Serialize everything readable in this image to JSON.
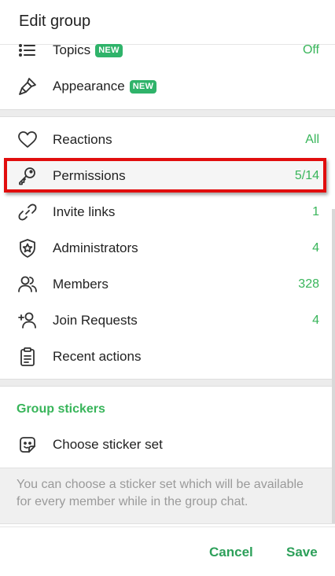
{
  "header": {
    "title": "Edit group"
  },
  "rows": {
    "topics": {
      "label": "Topics",
      "badge": "NEW",
      "value": "Off",
      "icon": "list-icon"
    },
    "appearance": {
      "label": "Appearance",
      "badge": "NEW",
      "icon": "brush-icon"
    },
    "reactions": {
      "label": "Reactions",
      "value": "All",
      "icon": "heart-icon"
    },
    "permissions": {
      "label": "Permissions",
      "value": "5/14",
      "icon": "key-icon"
    },
    "invite_links": {
      "label": "Invite links",
      "value": "1",
      "icon": "link-icon"
    },
    "administrators": {
      "label": "Administrators",
      "value": "4",
      "icon": "shield-star-icon"
    },
    "members": {
      "label": "Members",
      "value": "328",
      "icon": "users-icon"
    },
    "join_requests": {
      "label": "Join Requests",
      "value": "4",
      "icon": "add-user-icon"
    },
    "recent_actions": {
      "label": "Recent actions",
      "icon": "clipboard-icon"
    }
  },
  "stickers": {
    "section_title": "Group stickers",
    "choose_label": "Choose sticker set",
    "choose_icon": "sticker-icon",
    "info_text": "You can choose a sticker set which will be available for every member while in the group chat."
  },
  "footer": {
    "cancel_label": "Cancel",
    "save_label": "Save"
  },
  "colors": {
    "accent": "#38b55a",
    "badge": "#2fb36a",
    "highlight": "#e10d0d"
  }
}
